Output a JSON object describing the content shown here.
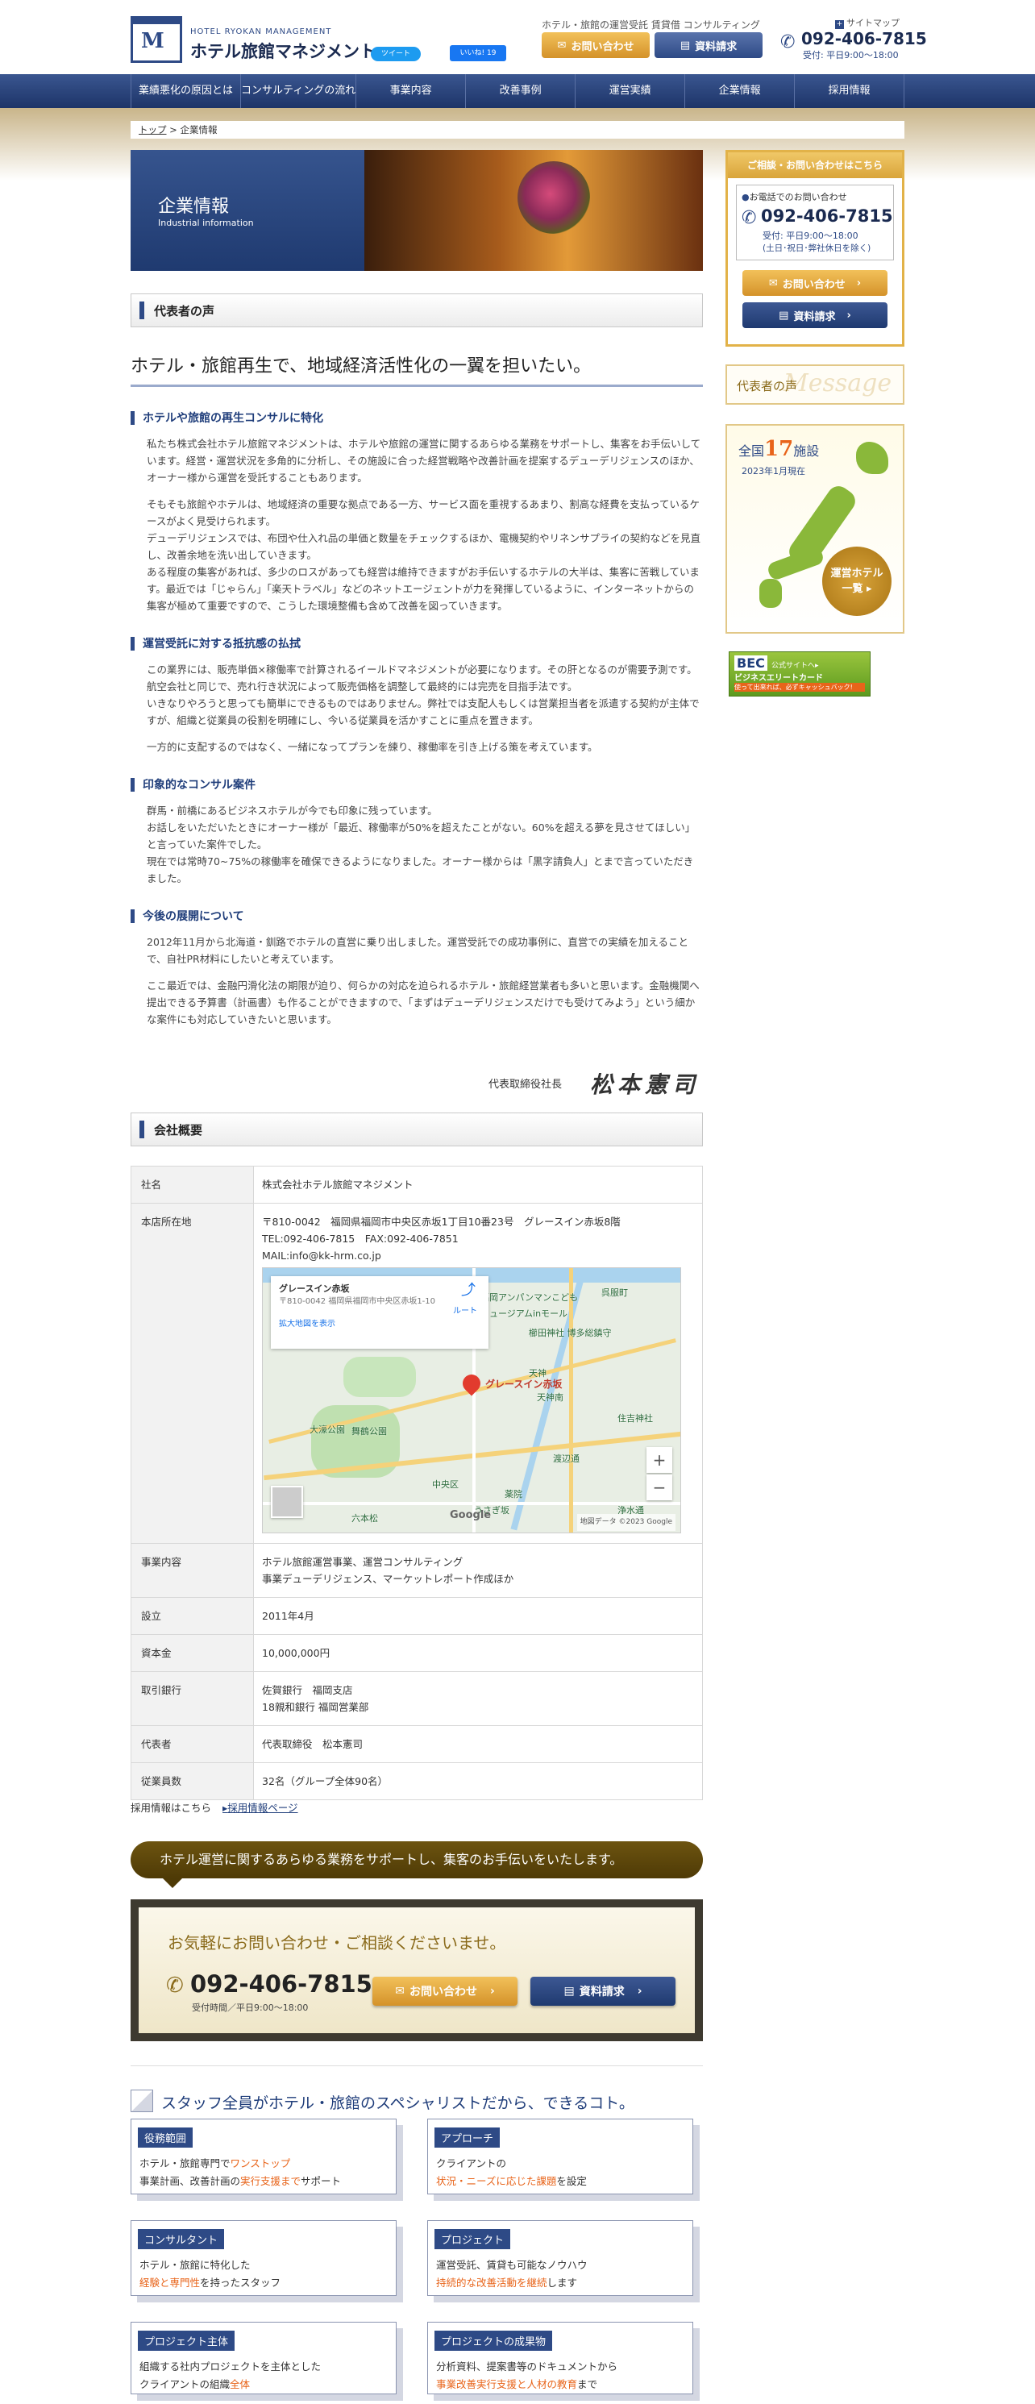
{
  "header": {
    "logo_en": "HOTEL RYOKAN MANAGEMENT",
    "logo_jp": "ホテル旅館マネジメント",
    "tagline": "ホテル・旅館の運営受託 賃貸借 コンサルティング",
    "sitemap": "サイトマップ",
    "btn_contact": "お問い合わせ",
    "btn_docs": "資料請求",
    "phone": "092-406-7815",
    "hours": "受付: 平日9:00〜18:00",
    "tweet": "ツイート",
    "like": "いいね! 19"
  },
  "nav": [
    "業績悪化の原因とは",
    "コンサルティングの流れ",
    "事業内容",
    "改善事例",
    "運営実績",
    "企業情報",
    "採用情報"
  ],
  "breadcrumb": {
    "top": "トップ",
    "sep": " > ",
    "current": "企業情報"
  },
  "hero": {
    "title": "企業情報",
    "sub": "Industrial information"
  },
  "sec_voice": "代表者の声",
  "lead": "ホテル・旅館再生で、地域経済活性化の一翼を担いたい。",
  "blocks": [
    {
      "h": "ホテルや旅館の再生コンサルに特化",
      "p": [
        "私たち株式会社ホテル旅館マネジメントは、ホテルや旅館の運営に関するあらゆる業務をサポートし、集客をお手伝いしています。経営・運営状況を多角的に分析し、その施設に合った経営戦略や改善計画を提案するデューデリジェンスのほか、オーナー様から運営を受託することもあります。",
        "そもそも旅館やホテルは、地域経済の重要な拠点である一方、サービス面を重視するあまり、割高な経費を支払っているケースがよく見受けられます。",
        "デューデリジェンスでは、布団や仕入れ品の単価と数量をチェックするほか、電機契約やリネンサプライの契約などを見直し、改善余地を洗い出していきます。",
        "ある程度の集客があれば、多少のロスがあっても経営は維持できますがお手伝いするホテルの大半は、集客に苦戦しています。最近では「じゃらん」「楽天トラベル」などのネットエージェントが力を発揮しているように、インターネットからの集客が極めて重要ですので、こうした環境整備も含めて改善を図っていきます。"
      ]
    },
    {
      "h": "運営受託に対する抵抗感の払拭",
      "p": [
        "この業界には、販売単価×稼働率で計算されるイールドマネジメントが必要になります。その肝となるのが需要予測です。航空会社と同じで、売れ行き状況によって販売価格を調整して最終的には完売を目指手法です。",
        "いきなりやろうと思っても簡単にできるものではありません。弊社では支配人もしくは営業担当者を派遣する契約が主体ですが、組織と従業員の役割を明確にし、今いる従業員を活かすことに重点を置きます。",
        "一方的に支配するのではなく、一緒になってプランを練り、稼働率を引き上げる策を考えています。"
      ]
    },
    {
      "h": "印象的なコンサル案件",
      "p": [
        "群馬・前橋にあるビジネスホテルが今でも印象に残っています。",
        "お話しをいただいたときにオーナー様が「最近、稼働率が50%を超えたことがない。60%を超える夢を見させてほしい」と言っていた案件でした。",
        "現在では常時70~75%の稼働率を確保できるようになりました。オーナー様からは「黒字請負人」とまで言っていただきました。"
      ]
    },
    {
      "h": "今後の展開について",
      "p": [
        "2012年11月から北海道・釧路でホテルの直営に乗り出しました。運営受託での成功事例に、直営での実績を加えることで、自社PR材料にしたいと考えています。",
        "ここ最近では、金融円滑化法の期限が迫り、何らかの対応を迫られるホテル・旅館経営業者も多いと思います。金融機関へ提出できる予算書（計画書）も作ることができますので、「まずはデューデリジェンスだけでも受けてみよう」という細かな案件にも対応していきたいと思います。"
      ]
    }
  ],
  "sign": {
    "role": "代表取締役社長",
    "name": "松本憲司"
  },
  "sec_company": "会社概要",
  "company": [
    {
      "k": "社名",
      "v": [
        "株式会社ホテル旅館マネジメント"
      ]
    },
    {
      "k": "本店所在地",
      "v": [
        "〒810-0042　福岡県福岡市中央区赤坂1丁目10番23号　グレースイン赤坂8階",
        "TEL:092-406-7815　FAX:092-406-7851",
        "MAIL:info@kk-hrm.co.jp"
      ]
    },
    {
      "k": "事業内容",
      "v": [
        "ホテル旅館運営事業、運営コンサルティング",
        "事業デューデリジェンス、マーケットレポート作成ほか"
      ]
    },
    {
      "k": "設立",
      "v": [
        "2011年4月"
      ]
    },
    {
      "k": "資本金",
      "v": [
        "10,000,000円"
      ]
    },
    {
      "k": "取引銀行",
      "v": [
        "佐賀銀行　福岡支店",
        "18親和銀行 福岡営業部"
      ]
    },
    {
      "k": "代表者",
      "v": [
        "代表取締役　松本憲司"
      ]
    },
    {
      "k": "従業員数",
      "v": [
        "32名（グループ全体90名）"
      ]
    }
  ],
  "map": {
    "pin_label": "グレースイン赤坂",
    "place_title": "グレースイン赤坂",
    "place_addr": "〒810-0042 福岡県福岡市中央区赤坂1-10",
    "place_link": "拡大地図を表示",
    "route": "ルート",
    "labels": [
      "大濠公園",
      "舞鶴公園",
      "中央区",
      "天神",
      "天神南",
      "住吉神社",
      "福岡アンパンマンこども",
      "ミュージアムinモール",
      "櫛田神社 博多総鎮守",
      "六本松",
      "薬院",
      "渡辺通",
      "浄水通",
      "呉服町",
      "うさぎ坂"
    ],
    "zoom_in": "+",
    "zoom_out": "−",
    "google": "Google",
    "copyright": "地図データ ©2023 Google"
  },
  "recruit": {
    "label": "採用情報はこちら",
    "link": "採用情報ページ"
  },
  "banner": "ホテル運営に関するあらゆる業務をサポートし、集客のお手伝いをいたします。",
  "cta": {
    "title": "お気軽にお問い合わせ・ご相談くださいませ。",
    "phone": "092-406-7815",
    "hours": "受付時間／平日9:00〜18:00",
    "contact": "お問い合わせ",
    "docs": "資料請求"
  },
  "spec_title": "スタッフ全員がホテル・旅館のスペシャリストだから、できるコト。",
  "cards": [
    {
      "t": "役務範囲",
      "l1": [
        {
          "s": "ホテル・旅館専門で"
        },
        {
          "s": "ワンストップ",
          "o": true
        }
      ],
      "l2": [
        {
          "s": "事業計画、改善計画の"
        },
        {
          "s": "実行支援まで",
          "o": true
        },
        {
          "s": "サポート"
        }
      ]
    },
    {
      "t": "アプローチ",
      "l1": [
        {
          "s": "クライアントの"
        }
      ],
      "l2": [
        {
          "s": "状況・ニーズに応じた課題",
          "o": true
        },
        {
          "s": "を設定"
        }
      ]
    },
    {
      "t": "コンサルタント",
      "l1": [
        {
          "s": "ホテル・旅館に特化した"
        }
      ],
      "l2": [
        {
          "s": "経験と専門性",
          "o": true
        },
        {
          "s": "を持ったスタッフ"
        }
      ]
    },
    {
      "t": "プロジェクト",
      "l1": [
        {
          "s": "運営受託、賃貸も可能なノウハウ"
        }
      ],
      "l2": [
        {
          "s": "持続的な改善活動を継続",
          "o": true
        },
        {
          "s": "します"
        }
      ]
    },
    {
      "t": "プロジェクト主体",
      "l1": [
        {
          "s": "組織する社内プロジェクトを主体とした"
        }
      ],
      "l2": [
        {
          "s": "クライアントの組織"
        },
        {
          "s": "全体",
          "o": true
        }
      ]
    },
    {
      "t": "プロジェクトの成果物",
      "l1": [
        {
          "s": "分析資料、提案書等のドキュメントから"
        }
      ],
      "l2": [
        {
          "s": "事業改善実行支援と人材の教育",
          "o": true
        },
        {
          "s": "まで"
        }
      ]
    }
  ],
  "side": {
    "box_title": "ご相談・お問い合わせはこちら",
    "phone_label": "お電話でのお問い合わせ",
    "phone": "092-406-7815",
    "hours1": "受付: 平日9:00〜18:00",
    "hours2": "(土日･祝日･弊社休日を除く)",
    "contact": "お問い合わせ",
    "docs": "資料請求",
    "voice": "代表者の声",
    "voice_en": "Message",
    "count_prefix": "全国",
    "count_num": "17",
    "count_suffix": "施設",
    "count_date": "2023年1月現在",
    "hotels_btn1": "運営ホテル",
    "hotels_btn2": "一覧 ▸",
    "bec1": "BEC",
    "bec2": "公式サイトへ▸",
    "bec3": "ビジネスエリートカード",
    "bec4": "使って出来れば、必ずキャッシュバック!"
  },
  "colors": {
    "navy": "#1f3d7a",
    "gold": "#d9a43a",
    "orange": "#e8641a"
  }
}
